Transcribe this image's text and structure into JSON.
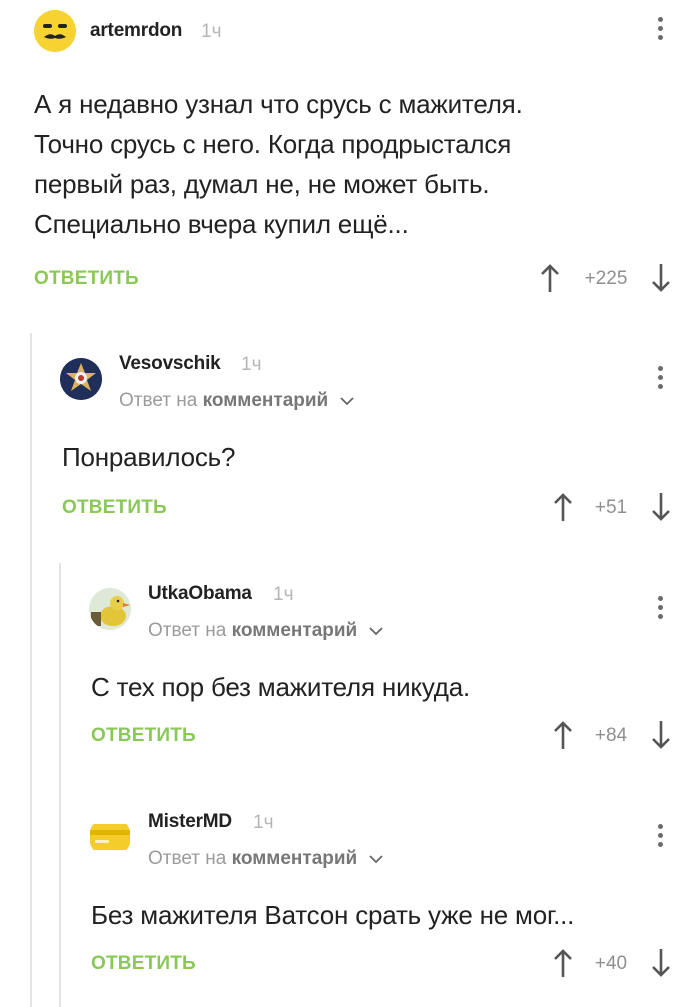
{
  "comments": [
    {
      "author": "artemrdon",
      "time": "1ч",
      "avatar": "mustache-smiley-avatar",
      "text_lines": [
        "А я недавно узнал что срусь с мажителя.",
        "Точно срусь с него. Когда продрыстался",
        "первый раз, думал не, не может быть.",
        "Специально вчера купил ещё..."
      ],
      "reply_label": "ОТВЕТИТЬ",
      "rating": "+225"
    },
    {
      "author": "Vesovschik",
      "time": "1ч",
      "avatar": "badge-avatar",
      "reply_prefix": "Ответ на",
      "reply_target": "комментарий",
      "text_lines": [
        "Понравилось?"
      ],
      "reply_label": "ОТВЕТИТЬ",
      "rating": "+51"
    },
    {
      "author": "UtkaObama",
      "time": "1ч",
      "avatar": "duck-avatar",
      "reply_prefix": "Ответ на",
      "reply_target": "комментарий",
      "text_lines": [
        "С тех пор без мажителя никуда."
      ],
      "reply_label": "ОТВЕТИТЬ",
      "rating": "+84"
    },
    {
      "author": "MisterMD",
      "time": "1ч",
      "avatar": "card-avatar",
      "reply_prefix": "Ответ на",
      "reply_target": "комментарий",
      "text_lines": [
        "Без мажителя Ватсон срать уже не мог..."
      ],
      "reply_label": "ОТВЕТИТЬ",
      "rating": "+40"
    }
  ],
  "colors": {
    "accent_green": "#8ac858",
    "muted_gray": "#9b9b9b",
    "thread_line": "#e3e3e3"
  }
}
